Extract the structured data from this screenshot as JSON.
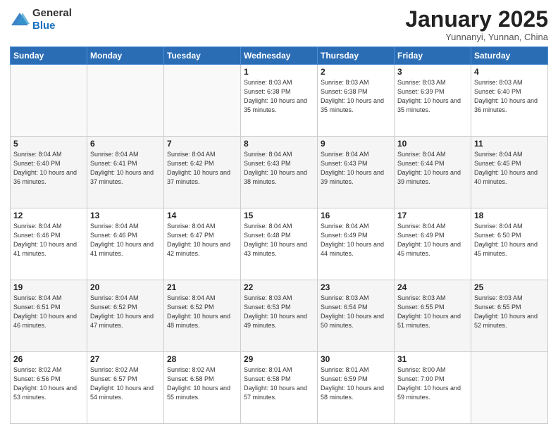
{
  "header": {
    "logo_general": "General",
    "logo_blue": "Blue",
    "month_title": "January 2025",
    "subtitle": "Yunnanyi, Yunnan, China"
  },
  "days_of_week": [
    "Sunday",
    "Monday",
    "Tuesday",
    "Wednesday",
    "Thursday",
    "Friday",
    "Saturday"
  ],
  "weeks": [
    [
      {
        "day": "",
        "info": ""
      },
      {
        "day": "",
        "info": ""
      },
      {
        "day": "",
        "info": ""
      },
      {
        "day": "1",
        "info": "Sunrise: 8:03 AM\nSunset: 6:38 PM\nDaylight: 10 hours\nand 35 minutes."
      },
      {
        "day": "2",
        "info": "Sunrise: 8:03 AM\nSunset: 6:38 PM\nDaylight: 10 hours\nand 35 minutes."
      },
      {
        "day": "3",
        "info": "Sunrise: 8:03 AM\nSunset: 6:39 PM\nDaylight: 10 hours\nand 35 minutes."
      },
      {
        "day": "4",
        "info": "Sunrise: 8:03 AM\nSunset: 6:40 PM\nDaylight: 10 hours\nand 36 minutes."
      }
    ],
    [
      {
        "day": "5",
        "info": "Sunrise: 8:04 AM\nSunset: 6:40 PM\nDaylight: 10 hours\nand 36 minutes."
      },
      {
        "day": "6",
        "info": "Sunrise: 8:04 AM\nSunset: 6:41 PM\nDaylight: 10 hours\nand 37 minutes."
      },
      {
        "day": "7",
        "info": "Sunrise: 8:04 AM\nSunset: 6:42 PM\nDaylight: 10 hours\nand 37 minutes."
      },
      {
        "day": "8",
        "info": "Sunrise: 8:04 AM\nSunset: 6:43 PM\nDaylight: 10 hours\nand 38 minutes."
      },
      {
        "day": "9",
        "info": "Sunrise: 8:04 AM\nSunset: 6:43 PM\nDaylight: 10 hours\nand 39 minutes."
      },
      {
        "day": "10",
        "info": "Sunrise: 8:04 AM\nSunset: 6:44 PM\nDaylight: 10 hours\nand 39 minutes."
      },
      {
        "day": "11",
        "info": "Sunrise: 8:04 AM\nSunset: 6:45 PM\nDaylight: 10 hours\nand 40 minutes."
      }
    ],
    [
      {
        "day": "12",
        "info": "Sunrise: 8:04 AM\nSunset: 6:46 PM\nDaylight: 10 hours\nand 41 minutes."
      },
      {
        "day": "13",
        "info": "Sunrise: 8:04 AM\nSunset: 6:46 PM\nDaylight: 10 hours\nand 41 minutes."
      },
      {
        "day": "14",
        "info": "Sunrise: 8:04 AM\nSunset: 6:47 PM\nDaylight: 10 hours\nand 42 minutes."
      },
      {
        "day": "15",
        "info": "Sunrise: 8:04 AM\nSunset: 6:48 PM\nDaylight: 10 hours\nand 43 minutes."
      },
      {
        "day": "16",
        "info": "Sunrise: 8:04 AM\nSunset: 6:49 PM\nDaylight: 10 hours\nand 44 minutes."
      },
      {
        "day": "17",
        "info": "Sunrise: 8:04 AM\nSunset: 6:49 PM\nDaylight: 10 hours\nand 45 minutes."
      },
      {
        "day": "18",
        "info": "Sunrise: 8:04 AM\nSunset: 6:50 PM\nDaylight: 10 hours\nand 45 minutes."
      }
    ],
    [
      {
        "day": "19",
        "info": "Sunrise: 8:04 AM\nSunset: 6:51 PM\nDaylight: 10 hours\nand 46 minutes."
      },
      {
        "day": "20",
        "info": "Sunrise: 8:04 AM\nSunset: 6:52 PM\nDaylight: 10 hours\nand 47 minutes."
      },
      {
        "day": "21",
        "info": "Sunrise: 8:04 AM\nSunset: 6:52 PM\nDaylight: 10 hours\nand 48 minutes."
      },
      {
        "day": "22",
        "info": "Sunrise: 8:03 AM\nSunset: 6:53 PM\nDaylight: 10 hours\nand 49 minutes."
      },
      {
        "day": "23",
        "info": "Sunrise: 8:03 AM\nSunset: 6:54 PM\nDaylight: 10 hours\nand 50 minutes."
      },
      {
        "day": "24",
        "info": "Sunrise: 8:03 AM\nSunset: 6:55 PM\nDaylight: 10 hours\nand 51 minutes."
      },
      {
        "day": "25",
        "info": "Sunrise: 8:03 AM\nSunset: 6:55 PM\nDaylight: 10 hours\nand 52 minutes."
      }
    ],
    [
      {
        "day": "26",
        "info": "Sunrise: 8:02 AM\nSunset: 6:56 PM\nDaylight: 10 hours\nand 53 minutes."
      },
      {
        "day": "27",
        "info": "Sunrise: 8:02 AM\nSunset: 6:57 PM\nDaylight: 10 hours\nand 54 minutes."
      },
      {
        "day": "28",
        "info": "Sunrise: 8:02 AM\nSunset: 6:58 PM\nDaylight: 10 hours\nand 55 minutes."
      },
      {
        "day": "29",
        "info": "Sunrise: 8:01 AM\nSunset: 6:58 PM\nDaylight: 10 hours\nand 57 minutes."
      },
      {
        "day": "30",
        "info": "Sunrise: 8:01 AM\nSunset: 6:59 PM\nDaylight: 10 hours\nand 58 minutes."
      },
      {
        "day": "31",
        "info": "Sunrise: 8:00 AM\nSunset: 7:00 PM\nDaylight: 10 hours\nand 59 minutes."
      },
      {
        "day": "",
        "info": ""
      }
    ]
  ]
}
